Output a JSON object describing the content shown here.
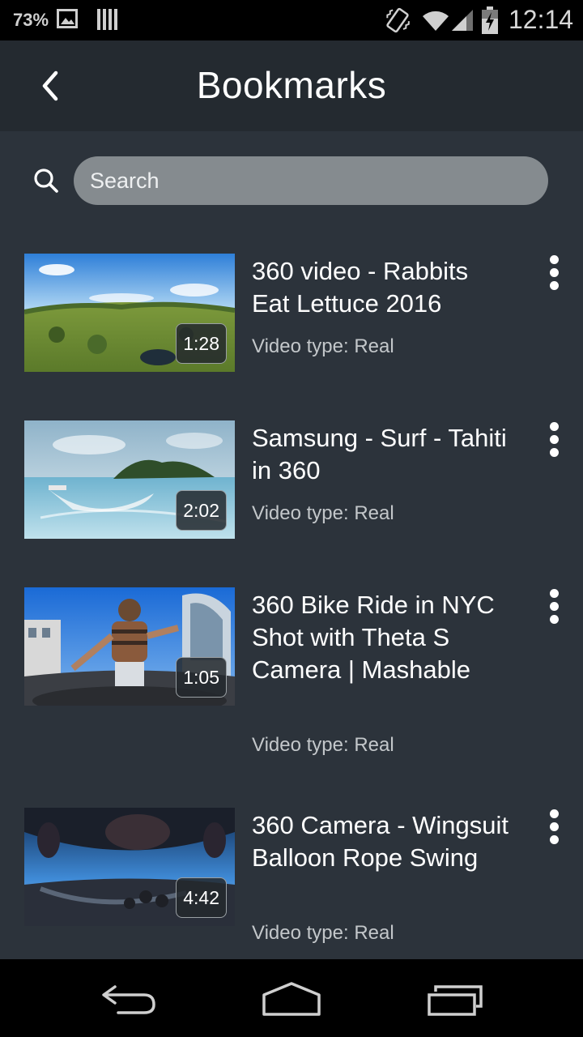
{
  "status_bar": {
    "battery_percent": "73%",
    "time": "12:14",
    "icons": [
      "image-icon",
      "barcode-icon",
      "vibrate-icon",
      "wifi-icon",
      "signal-icon",
      "battery-charging-icon"
    ]
  },
  "app_bar": {
    "title": "Bookmarks",
    "back_icon": "chevron-left-icon"
  },
  "search": {
    "placeholder": "Search",
    "value": "",
    "icon": "search-icon"
  },
  "items": [
    {
      "title": "360 video - Rabbits Eat Lettuce 2016",
      "type": "Video type: Real",
      "duration": "1:28"
    },
    {
      "title": "Samsung - Surf - Tahiti in 360",
      "type": "Video type: Real",
      "duration": "2:02"
    },
    {
      "title": "360 Bike Ride in NYC Shot with Theta S Camera | Mashable",
      "type": "Video type: Real",
      "duration": "1:05"
    },
    {
      "title": "360 Camera - Wingsuit Balloon Rope Swing",
      "type": "Video type: Real",
      "duration": "4:42"
    }
  ],
  "nav_bar": {
    "icons": [
      "nav-back-icon",
      "nav-home-icon",
      "nav-recents-icon"
    ]
  },
  "colors": {
    "background": "#2c333b",
    "app_bar": "#242a30",
    "search_field": "#858b8f",
    "secondary_text": "#c3c7ca"
  }
}
